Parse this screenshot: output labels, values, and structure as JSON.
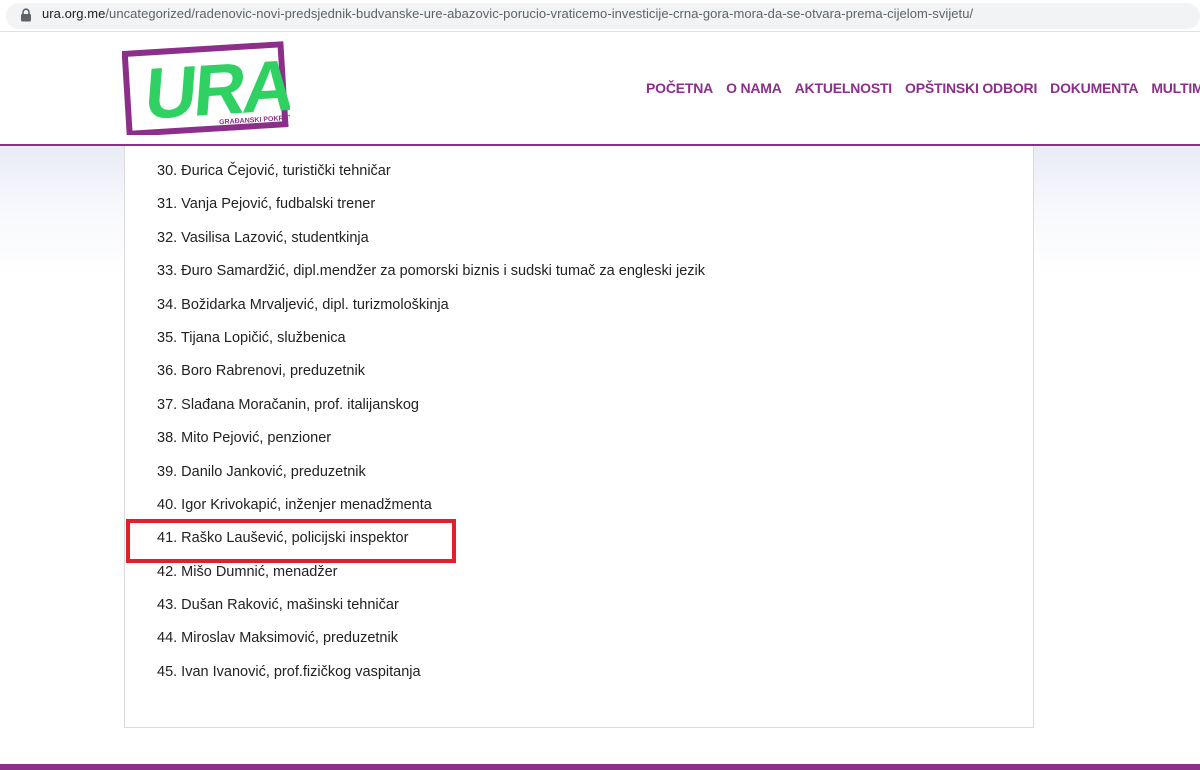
{
  "browser": {
    "url_domain": "ura.org.me",
    "url_path": "/uncategorized/radenovic-novi-predsjednik-budvanske-ure-abazovic-porucio-vraticemo-investicije-crna-gora-mora-da-se-otvara-prema-cijelom-svijetu/"
  },
  "logo": {
    "wordmark": "URA",
    "tagline": "GRAĐANSKI POKRET",
    "colors": {
      "frame": "#8b2f8a",
      "letters": "#2fd162"
    }
  },
  "nav": {
    "items": [
      "POČETNA",
      "O NAMA",
      "AKTUELNOSTI",
      "OPŠTINSKI ODBORI",
      "DOKUMENTA",
      "MULTIMEDIJA"
    ]
  },
  "list": {
    "items": [
      "30. Đurica Čejović, turistički tehničar",
      "31. Vanja Pejović, fudbalski trener",
      "32. Vasilisa Lazović, studentkinja",
      "33. Đuro Samardžić, dipl.mendžer za pomorski biznis i sudski tumač za engleski jezik",
      "34. Božidarka Mrvaljević, dipl. turizmološkinja",
      "35. Tijana Lopičić, službenica",
      "36. Boro Rabrenovi, preduzetnik",
      "37. Slađana Moračanin, prof. italijanskog",
      "38. Mito Pejović, penzioner",
      "39. Danilo Janković, preduzetnik",
      "40. Igor Krivokapić, inženjer menadžmenta",
      "41. Raško Laušević, policijski inspektor",
      "42. Mišo Dumnić, menadžer",
      "43. Dušan Raković, mašinski tehničar",
      "44. Miroslav Maksimović, preduzetnik",
      "45. Ivan Ivanović, prof.fizičkog vaspitanja"
    ],
    "highlighted_index": 11
  },
  "colors": {
    "brand_purple": "#8b2f8a",
    "highlight_red": "#e0202a"
  },
  "icons": {
    "lock": "lock-icon"
  }
}
